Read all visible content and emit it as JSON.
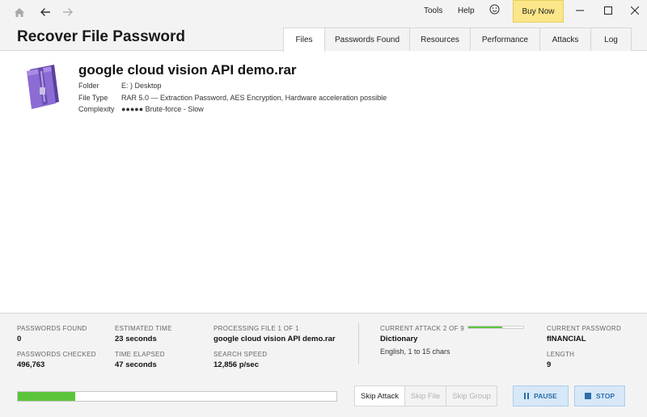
{
  "titlebar": {
    "home_icon": "home-icon",
    "back_icon": "arrow-left-icon",
    "forward_icon": "arrow-right-icon",
    "menu_tools": "Tools",
    "menu_help": "Help",
    "feedback_icon": "smiley-icon",
    "buy_now": "Buy Now",
    "minimize_icon": "minimize-icon",
    "maximize_icon": "maximize-icon",
    "close_icon": "close-icon"
  },
  "header": {
    "title": "Recover File Password",
    "tabs": [
      {
        "label": "Files",
        "active": true
      },
      {
        "label": "Passwords Found",
        "active": false
      },
      {
        "label": "Resources",
        "active": false
      },
      {
        "label": "Performance",
        "active": false
      },
      {
        "label": "Attacks",
        "active": false
      },
      {
        "label": "Log",
        "active": false
      }
    ]
  },
  "file": {
    "icon": "rar-archive-icon",
    "name": "google cloud vision API demo.rar",
    "folder_label": "Folder",
    "folder_value": "E: ) Desktop",
    "type_label": "File Type",
    "type_value": "RAR 5.0 — Extraction Password, AES Encryption, Hardware acceleration possible",
    "complexity_label": "Complexity",
    "complexity_value": "●●●●● Brute-force - Slow"
  },
  "stats": {
    "passwords_found_label": "PASSWORDS FOUND",
    "passwords_found_value": "0",
    "passwords_checked_label": "PASSWORDS CHECKED",
    "passwords_checked_value": "496,763",
    "estimated_time_label": "ESTIMATED TIME",
    "estimated_time_value": "23 seconds",
    "time_elapsed_label": "TIME ELAPSED",
    "time_elapsed_value": "47 seconds",
    "processing_label": "PROCESSING FILE 1 OF 1",
    "processing_value": "google cloud vision API demo.rar",
    "search_speed_label": "SEARCH SPEED",
    "search_speed_value": "12,856 p/sec",
    "current_attack_label": "CURRENT ATTACK 2 OF 9",
    "current_attack_value": "Dictionary",
    "current_attack_sub": "English, 1 to 15 chars",
    "attack_progress": 0.62,
    "current_password_label": "CURRENT PASSWORD",
    "current_password_value": "fINANCIAL",
    "length_label": "LENGTH",
    "length_value": "9"
  },
  "controls": {
    "overall_progress": 0.18,
    "skip_attack": "Skip Attack",
    "skip_file": "Skip File",
    "skip_group": "Skip Group",
    "pause": "PAUSE",
    "stop": "STOP",
    "colors": {
      "progress": "#5cc43c",
      "action_bg": "#d7e8f8",
      "action_text": "#2d6eaa",
      "buy_bg": "#fbe68a"
    }
  }
}
